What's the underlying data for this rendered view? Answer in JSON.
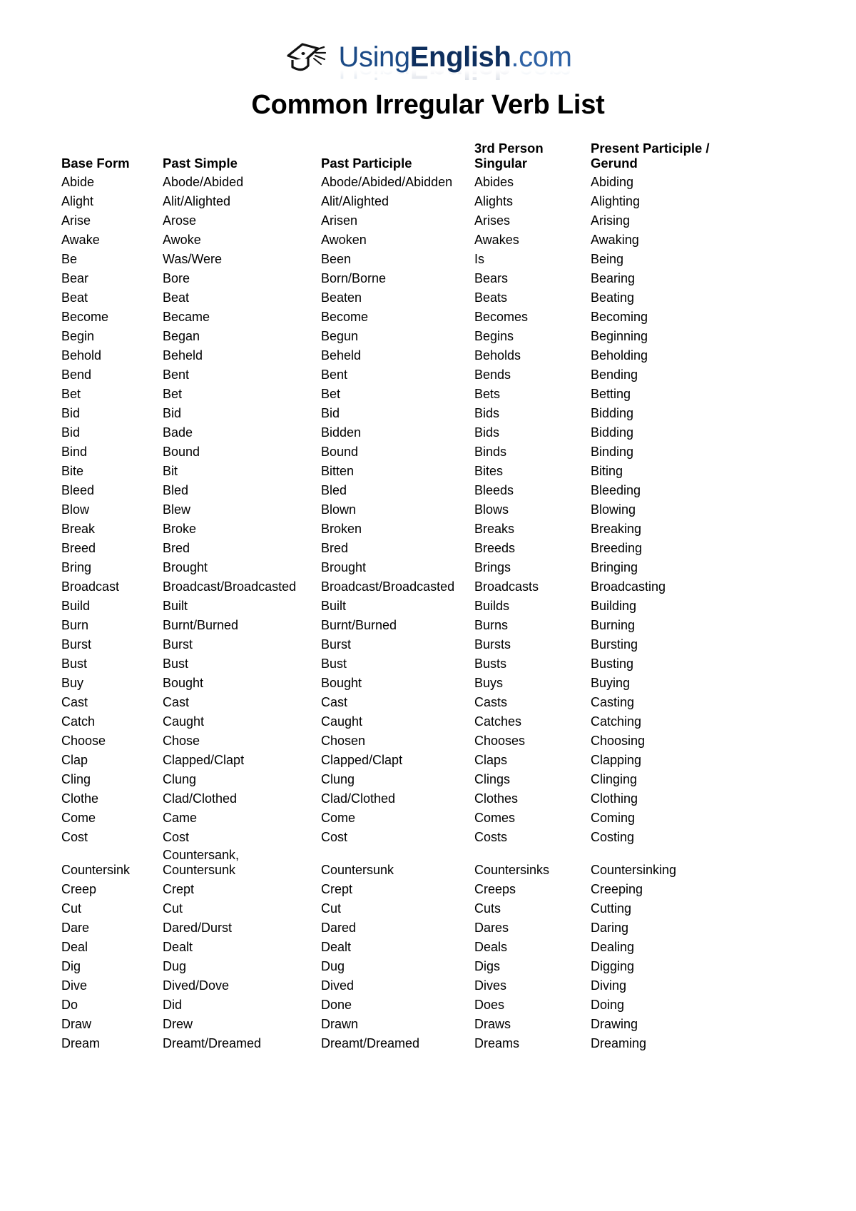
{
  "logo": {
    "icon": "graduation-cap-icon",
    "part1": "Using",
    "part2": "English",
    "part3": ".com",
    "full": "UsingEnglish.com",
    "color_dark": "#0E2F5E",
    "color_light": "#2E62A5"
  },
  "title": "Common Irregular Verb List",
  "table": {
    "headers": [
      "Base Form",
      "Past Simple",
      "Past Participle",
      "3rd Person\nSingular",
      "Present Participle /\nGerund"
    ],
    "rows": [
      [
        "Abide",
        "Abode/Abided",
        "Abode/Abided/Abidden",
        "Abides",
        "Abiding"
      ],
      [
        "Alight",
        "Alit/Alighted",
        "Alit/Alighted",
        "Alights",
        "Alighting"
      ],
      [
        "Arise",
        "Arose",
        "Arisen",
        "Arises",
        "Arising"
      ],
      [
        "Awake",
        "Awoke",
        "Awoken",
        "Awakes",
        "Awaking"
      ],
      [
        "Be",
        "Was/Were",
        "Been",
        "Is",
        "Being"
      ],
      [
        "Bear",
        "Bore",
        "Born/Borne",
        "Bears",
        "Bearing"
      ],
      [
        "Beat",
        "Beat",
        "Beaten",
        "Beats",
        "Beating"
      ],
      [
        "Become",
        "Became",
        "Become",
        "Becomes",
        "Becoming"
      ],
      [
        "Begin",
        "Began",
        "Begun",
        "Begins",
        "Beginning"
      ],
      [
        "Behold",
        "Beheld",
        "Beheld",
        "Beholds",
        "Beholding"
      ],
      [
        "Bend",
        "Bent",
        "Bent",
        "Bends",
        "Bending"
      ],
      [
        "Bet",
        "Bet",
        "Bet",
        "Bets",
        "Betting"
      ],
      [
        "Bid",
        "Bid",
        "Bid",
        "Bids",
        "Bidding"
      ],
      [
        "Bid",
        "Bade",
        "Bidden",
        "Bids",
        "Bidding"
      ],
      [
        "Bind",
        "Bound",
        "Bound",
        "Binds",
        "Binding"
      ],
      [
        "Bite",
        "Bit",
        "Bitten",
        "Bites",
        "Biting"
      ],
      [
        "Bleed",
        "Bled",
        "Bled",
        "Bleeds",
        "Bleeding"
      ],
      [
        "Blow",
        "Blew",
        "Blown",
        "Blows",
        "Blowing"
      ],
      [
        "Break",
        "Broke",
        "Broken",
        "Breaks",
        "Breaking"
      ],
      [
        "Breed",
        "Bred",
        "Bred",
        "Breeds",
        "Breeding"
      ],
      [
        "Bring",
        "Brought",
        "Brought",
        "Brings",
        "Bringing"
      ],
      [
        "Broadcast",
        "Broadcast/Broadcasted",
        "Broadcast/Broadcasted",
        "Broadcasts",
        "Broadcasting"
      ],
      [
        "Build",
        "Built",
        "Built",
        "Builds",
        "Building"
      ],
      [
        "Burn",
        "Burnt/Burned",
        "Burnt/Burned",
        "Burns",
        "Burning"
      ],
      [
        "Burst",
        "Burst",
        "Burst",
        "Bursts",
        "Bursting"
      ],
      [
        "Bust",
        "Bust",
        "Bust",
        "Busts",
        "Busting"
      ],
      [
        "Buy",
        "Bought",
        "Bought",
        "Buys",
        "Buying"
      ],
      [
        "Cast",
        "Cast",
        "Cast",
        "Casts",
        "Casting"
      ],
      [
        "Catch",
        "Caught",
        "Caught",
        "Catches",
        "Catching"
      ],
      [
        "Choose",
        "Chose",
        "Chosen",
        "Chooses",
        "Choosing"
      ],
      [
        "Clap",
        "Clapped/Clapt",
        "Clapped/Clapt",
        "Claps",
        "Clapping"
      ],
      [
        "Cling",
        "Clung",
        "Clung",
        "Clings",
        "Clinging"
      ],
      [
        "Clothe",
        "Clad/Clothed",
        "Clad/Clothed",
        "Clothes",
        "Clothing"
      ],
      [
        "Come",
        "Came",
        "Come",
        "Comes",
        "Coming"
      ],
      [
        "Cost",
        "Cost",
        "Cost",
        "Costs",
        "Costing"
      ],
      [
        "Countersink",
        "Countersank,\nCountersunk",
        "Countersunk",
        "Countersinks",
        "Countersinking"
      ],
      [
        "Creep",
        "Crept",
        "Crept",
        "Creeps",
        "Creeping"
      ],
      [
        "Cut",
        "Cut",
        "Cut",
        "Cuts",
        "Cutting"
      ],
      [
        "Dare",
        "Dared/Durst",
        "Dared",
        "Dares",
        "Daring"
      ],
      [
        "Deal",
        "Dealt",
        "Dealt",
        "Deals",
        "Dealing"
      ],
      [
        "Dig",
        "Dug",
        "Dug",
        "Digs",
        "Digging"
      ],
      [
        "Dive",
        "Dived/Dove",
        "Dived",
        "Dives",
        "Diving"
      ],
      [
        "Do",
        "Did",
        "Done",
        "Does",
        "Doing"
      ],
      [
        "Draw",
        "Drew",
        "Drawn",
        "Draws",
        "Drawing"
      ],
      [
        "Dream",
        "Dreamt/Dreamed",
        "Dreamt/Dreamed",
        "Dreams",
        "Dreaming"
      ]
    ]
  }
}
